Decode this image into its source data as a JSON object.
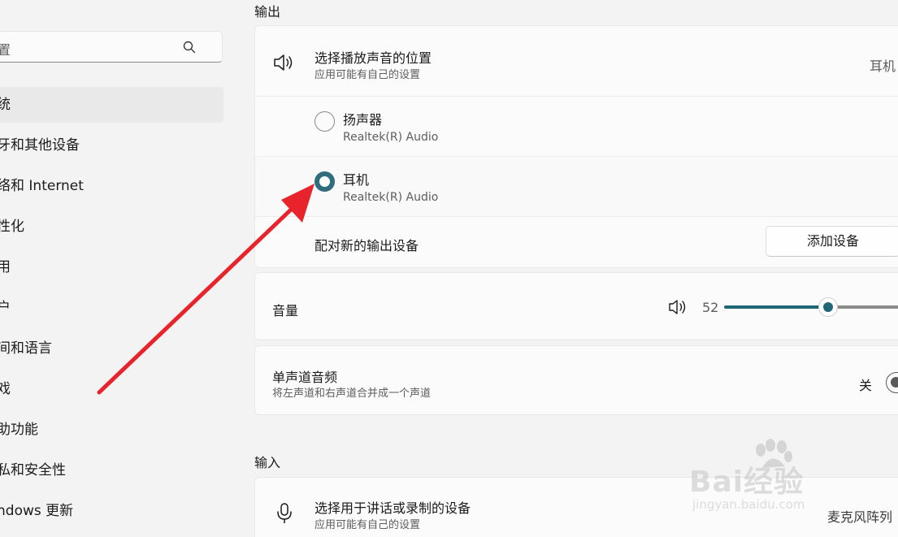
{
  "sidebar": {
    "search_text": "置",
    "items": [
      {
        "label": "统",
        "active": true
      },
      {
        "label": "牙和其他设备"
      },
      {
        "label": "络和 Internet"
      },
      {
        "label": "性化"
      },
      {
        "label": "用"
      },
      {
        "label": "户"
      },
      {
        "label": "间和语言"
      },
      {
        "label": "戏"
      },
      {
        "label": "助功能"
      },
      {
        "label": "私和安全性"
      },
      {
        "label": "ndows 更新"
      }
    ]
  },
  "output": {
    "section_title": "输出",
    "choose_title": "选择播放声音的位置",
    "choose_sub": "应用可能有自己的设置",
    "choose_value": "耳机",
    "devices": [
      {
        "name": "扬声器",
        "sub": "Realtek(R) Audio",
        "selected": false
      },
      {
        "name": "耳机",
        "sub": "Realtek(R) Audio",
        "selected": true
      }
    ],
    "pair_label": "配对新的输出设备",
    "add_device_button": "添加设备",
    "volume_label": "音量",
    "volume_value": "52",
    "volume_percent": 52,
    "mono_title": "单声道音频",
    "mono_sub": "将左声道和右声道合并成一个声道",
    "mono_state": "关"
  },
  "input": {
    "section_title": "输入",
    "choose_title": "选择用于讲话或录制的设备",
    "choose_sub": "应用可能有自己的设置",
    "choose_value": "麦克风阵列"
  },
  "watermark": {
    "brand_text": "Bai经验",
    "url": "jingyan.baidu.com"
  },
  "colors": {
    "accent": "#1f6774",
    "arrow": "#e8232b"
  }
}
